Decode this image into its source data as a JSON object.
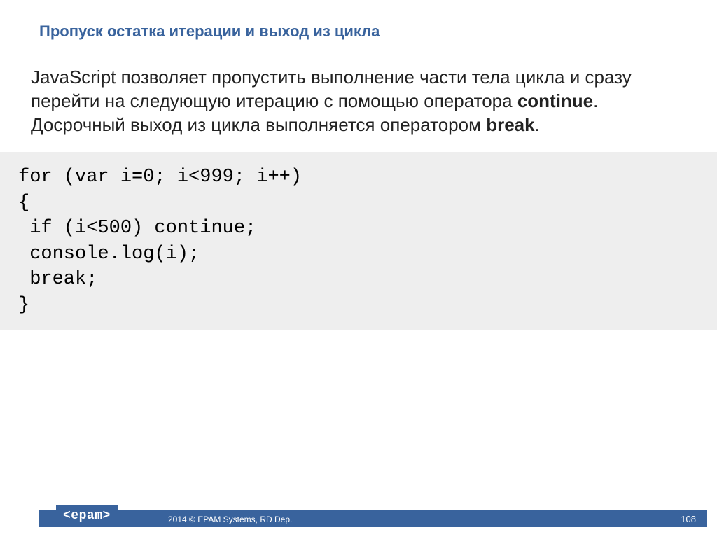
{
  "title": "Пропуск остатка итерации и выход из цикла",
  "paragraph": {
    "part1": "JavaScript позволяет пропустить выполнение части тела цикла и сразу перейти на следующую итерацию с помощью оператора ",
    "kw1": "continue",
    "part2": ". Досрочный выход из цикла выполняется оператором ",
    "kw2": "break",
    "part3": "."
  },
  "code": "for (var i=0; i<999; i++)\n{\n if (i<500) continue;\n console.log(i);\n break;\n}",
  "footer": {
    "logo": "<epam>",
    "copyright": "2014 © EPAM Systems, RD Dep.",
    "page": "108"
  }
}
